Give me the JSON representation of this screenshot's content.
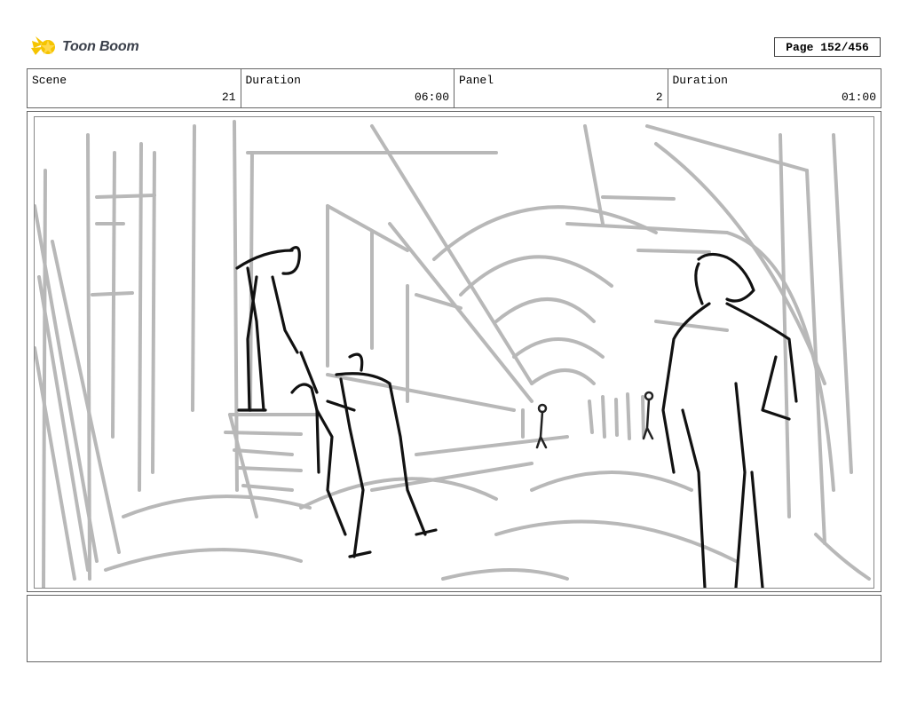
{
  "logo": {
    "text": "Toon Boom",
    "icon": "toon-boom-star-icon",
    "accent": "#f5c400"
  },
  "page": {
    "label": "Page 152/456"
  },
  "info": {
    "scene_label": "Scene",
    "scene_value": "21",
    "duration_label": "Duration",
    "duration_value": "06:00",
    "panel_label": "Panel",
    "panel_value": "2",
    "panel_duration_label": "Duration",
    "panel_duration_value": "01:00"
  },
  "notes": {
    "text": ""
  }
}
